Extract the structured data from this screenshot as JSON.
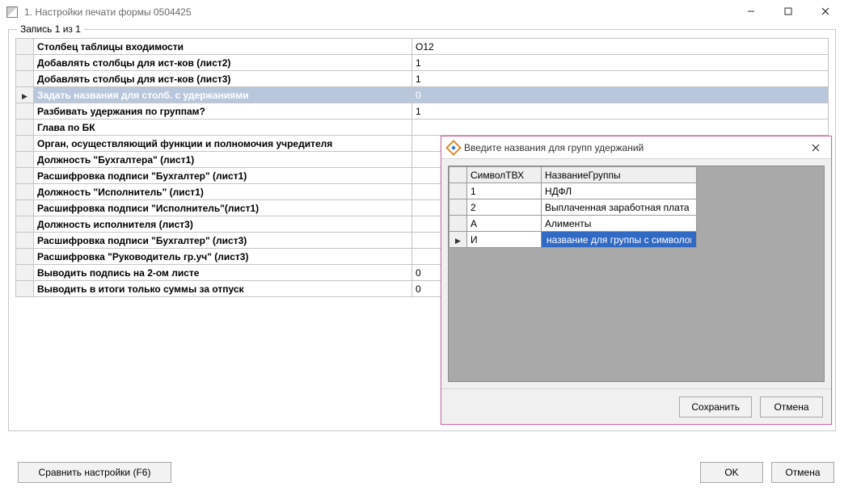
{
  "window": {
    "title": "1. Настройки печати формы 0504425"
  },
  "group": {
    "legend": "Запись 1 из 1"
  },
  "mainGrid": {
    "headers": {
      "label": "",
      "value": ""
    },
    "rows": [
      {
        "label": "Столбец таблицы входимости",
        "value": "O12",
        "selected": false
      },
      {
        "label": "Добавлять столбцы для ист-ков (лист2)",
        "value": "1",
        "selected": false
      },
      {
        "label": "Добавлять столбцы для ист-ков (лист3)",
        "value": "1",
        "selected": false
      },
      {
        "label": "Задать названия для столб. с удержаниями",
        "value": "0",
        "selected": true
      },
      {
        "label": "Разбивать удержания по группам?",
        "value": "1",
        "selected": false
      },
      {
        "label": "Глава по БК",
        "value": "",
        "selected": false
      },
      {
        "label": "Орган, осуществляющий функции и полномочия учредителя",
        "value": "",
        "selected": false
      },
      {
        "label": "Должность \"Бухгалтера\" (лист1)",
        "value": "",
        "selected": false
      },
      {
        "label": "Расшифровка подписи \"Бухгалтер\" (лист1)",
        "value": "",
        "selected": false
      },
      {
        "label": "Должность \"Исполнитель\" (лист1)",
        "value": "",
        "selected": false
      },
      {
        "label": "Расшифровка подписи \"Исполнитель\"(лист1)",
        "value": "",
        "selected": false
      },
      {
        "label": "Должность исполнителя (лист3)",
        "value": "",
        "selected": false
      },
      {
        "label": "Расшифровка подписи \"Бухгалтер\" (лист3)",
        "value": "",
        "selected": false
      },
      {
        "label": "Расшифровка \"Руководитель гр.уч\" (лист3)",
        "value": "",
        "selected": false
      },
      {
        "label": "Выводить подпись на 2-ом листе",
        "value": "0",
        "selected": false
      },
      {
        "label": "Выводить в итоги только суммы за отпуск",
        "value": "0",
        "selected": false
      }
    ]
  },
  "footer": {
    "compare": "Сравнить настройки (F6)",
    "ok": "OK",
    "cancel": "Отмена"
  },
  "dialog": {
    "title": "Введите названия для групп удержаний",
    "headers": {
      "symbol": "СимволТВХ",
      "name": "НазваниеГруппы"
    },
    "rows": [
      {
        "symbol": "1",
        "name": "НДФЛ",
        "current": false,
        "editing": false
      },
      {
        "symbol": "2",
        "name": "Выплаченная заработная плата",
        "current": false,
        "editing": false
      },
      {
        "symbol": "А",
        "name": "Алименты",
        "current": false,
        "editing": false
      },
      {
        "symbol": "И",
        "name": "название для группы с символом И",
        "current": true,
        "editing": true
      }
    ],
    "save": "Сохранить",
    "cancel": "Отмена"
  }
}
